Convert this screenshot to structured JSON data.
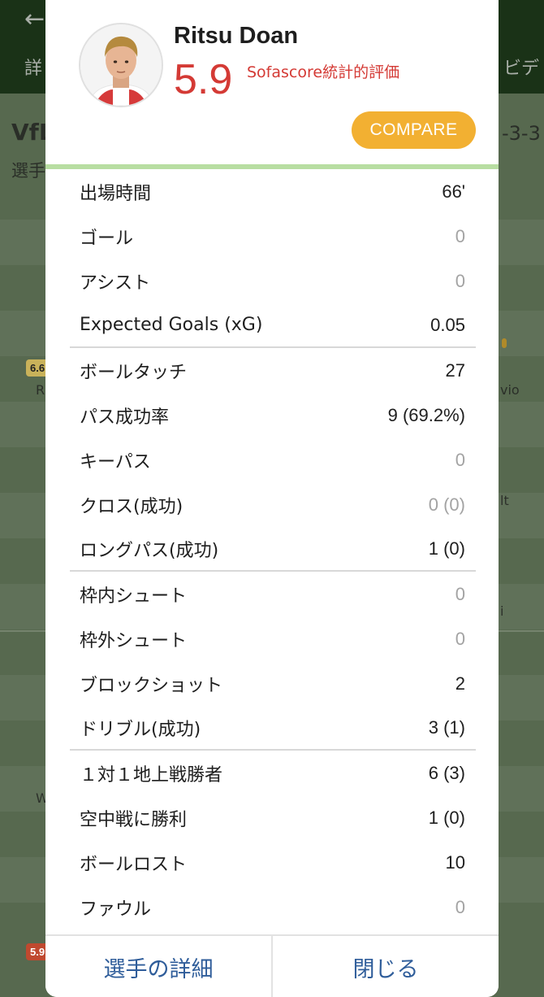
{
  "background": {
    "tab_left": "詳",
    "tab_right": "ビデ",
    "team_name": "VfL",
    "formation": "-3-3",
    "section_label": "選手",
    "badge_a": "6.6",
    "badge_b": "5.9",
    "player_r": "R",
    "player_vio": "vio",
    "player_lt": "lt",
    "player_w": "W",
    "player_i": "i"
  },
  "player": {
    "name": "Ritsu Doan",
    "rating": "5.9",
    "rating_label": "Sofascore統計的評価",
    "rating_color": "#d43a35"
  },
  "compare_button": "COMPARE",
  "stat_groups": [
    [
      {
        "label": "出場時間",
        "value": "66'",
        "muted": false
      },
      {
        "label": "ゴール",
        "value": "0",
        "muted": true
      },
      {
        "label": "アシスト",
        "value": "0",
        "muted": true
      },
      {
        "label": "Expected Goals (xG)",
        "value": "0.05",
        "muted": false
      }
    ],
    [
      {
        "label": "ボールタッチ",
        "value": "27",
        "muted": false
      },
      {
        "label": "パス成功率",
        "value": "9 (69.2%)",
        "muted": false
      },
      {
        "label": "キーパス",
        "value": "0",
        "muted": true
      },
      {
        "label": "クロス(成功)",
        "value": "0 (0)",
        "muted": true
      },
      {
        "label": "ロングパス(成功)",
        "value": "1 (0)",
        "muted": false
      }
    ],
    [
      {
        "label": "枠内シュート",
        "value": "0",
        "muted": true
      },
      {
        "label": "枠外シュート",
        "value": "0",
        "muted": true
      },
      {
        "label": "ブロックショット",
        "value": "2",
        "muted": false
      },
      {
        "label": "ドリブル(成功)",
        "value": "3 (1)",
        "muted": false
      }
    ],
    [
      {
        "label": "１対１地上戦勝者",
        "value": "6 (3)",
        "muted": false
      },
      {
        "label": "空中戦に勝利",
        "value": "1 (0)",
        "muted": false
      },
      {
        "label": "ボールロスト",
        "value": "10",
        "muted": false
      },
      {
        "label": "ファウル",
        "value": "0",
        "muted": true
      }
    ]
  ],
  "footer": {
    "details_button": "選手の詳細",
    "close_button": "閉じる"
  },
  "colors": {
    "accent": "#f2b032",
    "link": "#2f5d9a",
    "divider_green": "#b8dea2"
  }
}
